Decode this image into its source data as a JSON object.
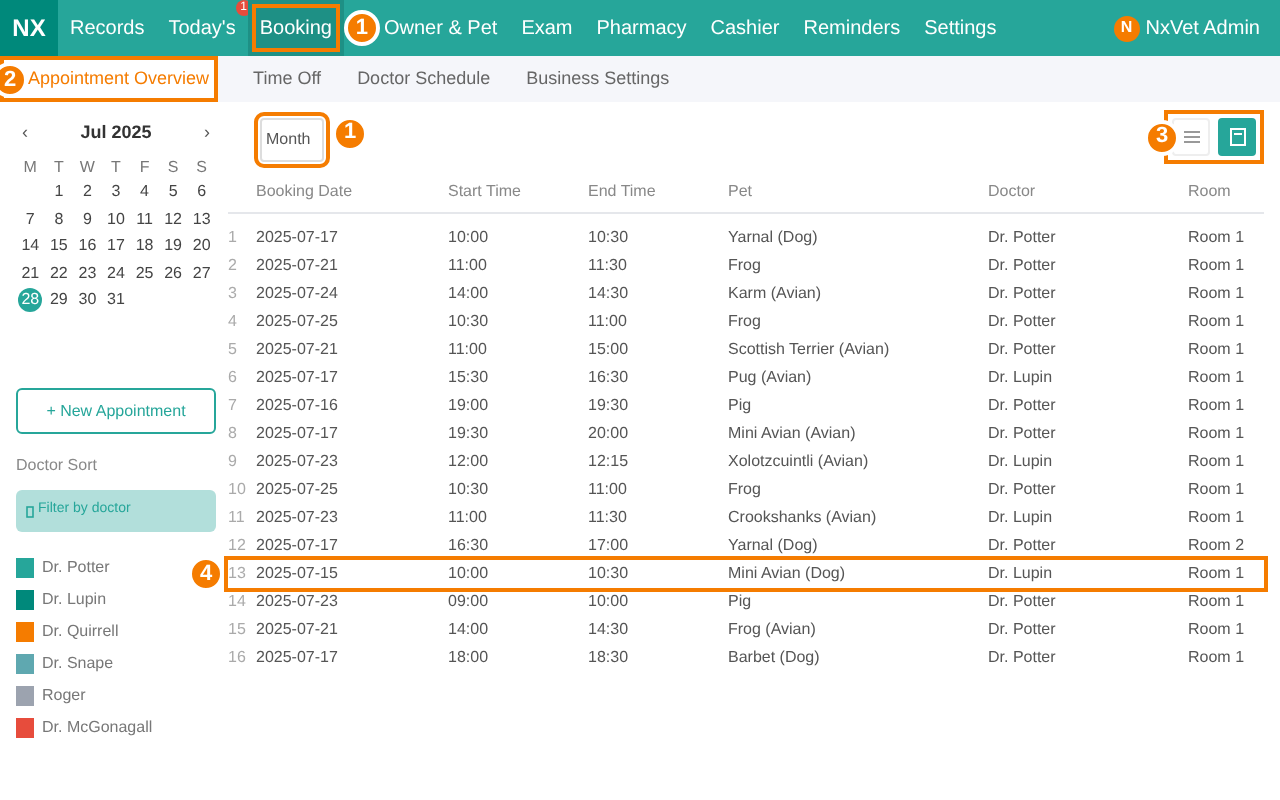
{
  "nav": {
    "logo": "NX",
    "items": [
      {
        "label": "Records",
        "selected": false
      },
      {
        "label": "Today's",
        "selected": false,
        "badge": "1"
      },
      {
        "label": "Booking",
        "selected": true,
        "callout": "1"
      },
      {
        "label": "Owner & Pet",
        "selected": false
      },
      {
        "label": "Exam",
        "selected": false
      },
      {
        "label": "Pharmacy",
        "selected": false
      },
      {
        "label": "Cashier",
        "selected": false
      },
      {
        "label": "Reminders",
        "selected": false
      },
      {
        "label": "Settings",
        "selected": false
      }
    ],
    "user": {
      "initial": "N",
      "name": "NxVet Admin"
    }
  },
  "subnav": [
    {
      "label": "Appointment Overview",
      "selected": true,
      "callout": "2"
    },
    {
      "label": "Time Off",
      "selected": false
    },
    {
      "label": "Doctor Schedule",
      "selected": false
    },
    {
      "label": "Business Settings",
      "selected": false
    }
  ],
  "calendar": {
    "prev": "‹",
    "next": "›",
    "month": "Jul 2025",
    "weekdays": [
      "M",
      "T",
      "W",
      "T",
      "F",
      "S",
      "S"
    ],
    "weeks": [
      [
        {
          "day": "1",
          "selected": false
        },
        {
          "day": "2",
          "selected": false
        },
        {
          "day": "3",
          "selected": false
        },
        {
          "day": "4",
          "selected": false
        },
        {
          "day": "5",
          "selected": false
        },
        {
          "day": "6",
          "selected": false
        }
      ],
      [
        {
          "day": "7",
          "selected": false
        },
        {
          "day": "8",
          "selected": false
        },
        {
          "day": "9",
          "selected": false
        },
        {
          "day": "10",
          "selected": false
        },
        {
          "day": "11",
          "selected": false
        },
        {
          "day": "12",
          "selected": false
        },
        {
          "day": "13",
          "selected": false
        }
      ],
      [
        {
          "day": "14",
          "selected": false
        },
        {
          "day": "15",
          "selected": false
        },
        {
          "day": "16",
          "selected": false
        },
        {
          "day": "17",
          "selected": false
        },
        {
          "day": "18",
          "selected": false
        },
        {
          "day": "19",
          "selected": false
        },
        {
          "day": "20",
          "selected": false
        }
      ],
      [
        {
          "day": "21",
          "selected": false
        },
        {
          "day": "22",
          "selected": false
        },
        {
          "day": "23",
          "selected": false
        },
        {
          "day": "24",
          "selected": false
        },
        {
          "day": "25",
          "selected": false
        },
        {
          "day": "26",
          "selected": false
        },
        {
          "day": "27",
          "selected": false
        }
      ],
      [
        {
          "day": "28",
          "selected": true
        },
        {
          "day": "29",
          "selected": false
        },
        {
          "day": "30",
          "selected": false
        },
        {
          "day": "31",
          "selected": false
        }
      ]
    ]
  },
  "new_appointment": "+ New Appointment",
  "doctor_sort": {
    "title": "Doctor Sort",
    "filter": "Filter by doctor",
    "doctors": [
      {
        "name": "Dr. Potter",
        "color": "#26a69a"
      },
      {
        "name": "Dr. Lupin",
        "color": "#00897b"
      },
      {
        "name": "Dr. Quirrell",
        "color": "#f57c00"
      },
      {
        "name": "Dr. Snape",
        "color": "#5fa8b0"
      },
      {
        "name": "Roger",
        "color": "#9ca3af"
      },
      {
        "name": "Dr. McGonagall",
        "color": "#e74c3c"
      }
    ]
  },
  "toolbar": {
    "month_button": "Month",
    "month_callout": "1",
    "views_callout": "3",
    "views": [
      {
        "kind": "list",
        "selected": false
      },
      {
        "kind": "calendar",
        "selected": true
      }
    ]
  },
  "table": {
    "columns": [
      "Booking Date",
      "Start Time",
      "End Time",
      "Pet",
      "Doctor",
      "Room"
    ],
    "rows": [
      {
        "n": "1",
        "cells": [
          "2025-07-17",
          "10:00",
          "10:30",
          "Yarnal (Dog)",
          "Dr. Potter",
          "Room 1"
        ]
      },
      {
        "n": "2",
        "cells": [
          "2025-07-21",
          "11:00",
          "11:30",
          "Frog",
          "Dr. Potter",
          "Room 1"
        ]
      },
      {
        "n": "3",
        "cells": [
          "2025-07-24",
          "14:00",
          "14:30",
          "Karm (Avian)",
          "Dr. Potter",
          "Room 1"
        ]
      },
      {
        "n": "4",
        "cells": [
          "2025-07-25",
          "10:30",
          "11:00",
          "Frog",
          "Dr. Potter",
          "Room 1"
        ]
      },
      {
        "n": "5",
        "cells": [
          "2025-07-21",
          "11:00",
          "15:00",
          "Scottish Terrier (Avian)",
          "Dr. Potter",
          "Room 1"
        ]
      },
      {
        "n": "6",
        "cells": [
          "2025-07-17",
          "15:30",
          "16:30",
          "Pug (Avian)",
          "Dr. Lupin",
          "Room 1"
        ]
      },
      {
        "n": "7",
        "cells": [
          "2025-07-16",
          "19:00",
          "19:30",
          "Pig",
          "Dr. Potter",
          "Room 1"
        ]
      },
      {
        "n": "8",
        "cells": [
          "2025-07-17",
          "19:30",
          "20:00",
          "Mini Avian (Avian)",
          "Dr. Potter",
          "Room 1"
        ]
      },
      {
        "n": "9",
        "cells": [
          "2025-07-23",
          "12:00",
          "12:15",
          "Xolotzcuintli (Avian)",
          "Dr. Lupin",
          "Room 1"
        ]
      },
      {
        "n": "10",
        "cells": [
          "2025-07-25",
          "10:30",
          "11:00",
          "Frog",
          "Dr. Potter",
          "Room 1"
        ]
      },
      {
        "n": "11",
        "cells": [
          "2025-07-23",
          "11:00",
          "11:30",
          "Crookshanks (Avian)",
          "Dr. Lupin",
          "Room 1"
        ]
      },
      {
        "n": "12",
        "cells": [
          "2025-07-17",
          "16:30",
          "17:00",
          "Yarnal (Dog)",
          "Dr. Potter",
          "Room 2"
        ]
      },
      {
        "n": "13",
        "cells": [
          "2025-07-15",
          "10:00",
          "10:30",
          "Mini Avian (Dog)",
          "Dr. Lupin",
          "Room 1"
        ],
        "callout": "4"
      },
      {
        "n": "14",
        "cells": [
          "2025-07-23",
          "09:00",
          "10:00",
          "Pig",
          "Dr. Potter",
          "Room 1"
        ]
      },
      {
        "n": "15",
        "cells": [
          "2025-07-21",
          "14:00",
          "14:30",
          "Frog (Avian)",
          "Dr. Potter",
          "Room 1"
        ]
      },
      {
        "n": "16",
        "cells": [
          "2025-07-17",
          "18:00",
          "18:30",
          "Barbet (Dog)",
          "Dr. Potter",
          "Room 1"
        ]
      }
    ]
  }
}
